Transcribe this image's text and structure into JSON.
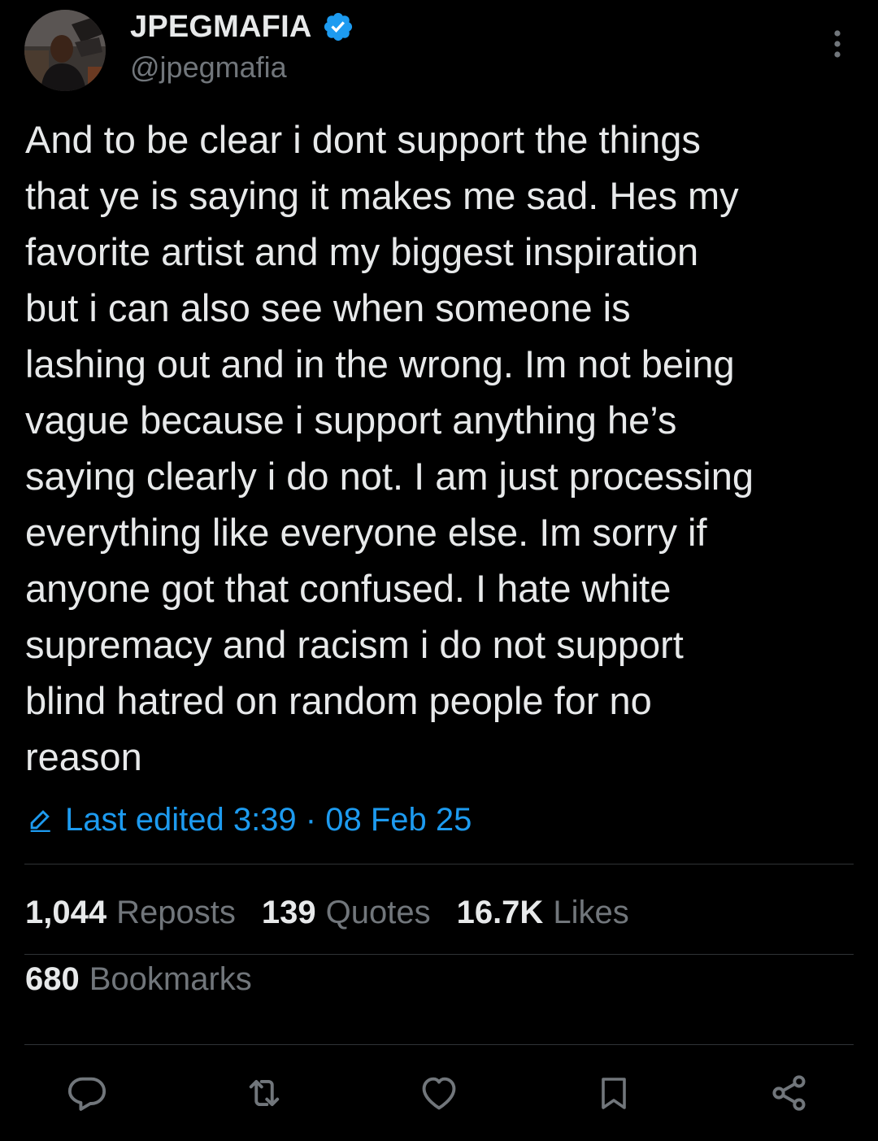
{
  "author": {
    "display_name": "JPEGMAFIA",
    "handle": "@jpegmafia",
    "verified_icon": "verified-badge-icon",
    "verified_color": "#1d9bf0",
    "avatar_icon": "profile-photo"
  },
  "menu": {
    "icon": "more-vertical-icon"
  },
  "tweet": {
    "text": "And to be clear i dont support the things\nthat ye is saying it makes me sad. Hes my\nfavorite artist and my biggest inspiration\nbut i can also see when someone is\nlashing out and in the wrong. Im not being\nvague because i support anything he’s\nsaying clearly i do not. I am just processing\neverything like everyone else. Im sorry if\nanyone got that confused. I hate white\nsupremacy and racism i do not support\nblind hatred on random people for no\nreason",
    "edited": {
      "icon": "pencil-edit-icon",
      "label": "Last edited 3:39 · 08 Feb 25"
    }
  },
  "stats": [
    {
      "count": "1,044",
      "label": "Reposts"
    },
    {
      "count": "139",
      "label": "Quotes"
    },
    {
      "count": "16.7K",
      "label": "Likes"
    }
  ],
  "bookmarks": {
    "count": "680",
    "label": "Bookmarks"
  },
  "actions": [
    {
      "icon": "reply-icon"
    },
    {
      "icon": "repost-icon"
    },
    {
      "icon": "like-icon"
    },
    {
      "icon": "bookmark-icon"
    },
    {
      "icon": "share-icon"
    }
  ],
  "colors": {
    "background": "#000000",
    "text_primary": "#e7e9ea",
    "text_secondary": "#71767b",
    "accent": "#1d9bf0",
    "divider": "#2f3336"
  }
}
